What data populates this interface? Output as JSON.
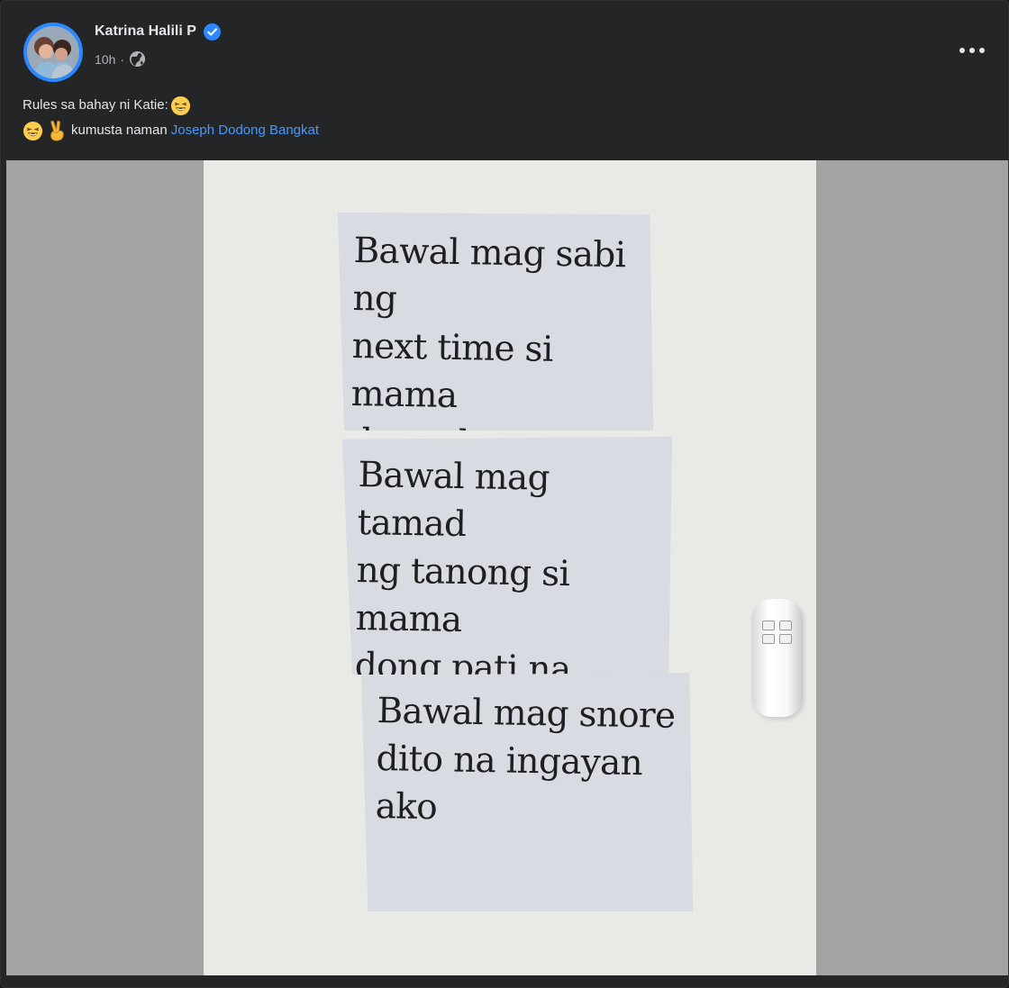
{
  "post": {
    "author": "Katrina Halili P",
    "timestamp": "10h",
    "separator": "·",
    "privacy_icon": "globe-icon",
    "verified_icon": "verified-check-icon",
    "more_icon": "more-options-icon",
    "text_line_1": "Rules sa bahay ni Katie:",
    "text_line_2_prefix": "kumusta naman",
    "mention": "Joseph Dodong Bangkat",
    "emoji_1": "laughing-face",
    "emoji_2": "laughing-face",
    "emoji_3": "victory-hand"
  },
  "photo": {
    "note_1": "Bawal mag sabi ng\nnext time si mama\ndong dapat sunod or\nmaking sa akin",
    "note_2": "Bawal mag tamad\nng tanong si mama\ndong pati na yung\nmga Hampalu",
    "note_3": "Bawal mag snore\ndito na ingayan\nako"
  },
  "colors": {
    "background": "#242526",
    "primary_text": "#e4e6eb",
    "secondary_text": "#b0b3b8",
    "link": "#4599ff",
    "verified": "#2d88ff",
    "media_background": "#a3a3a3"
  }
}
